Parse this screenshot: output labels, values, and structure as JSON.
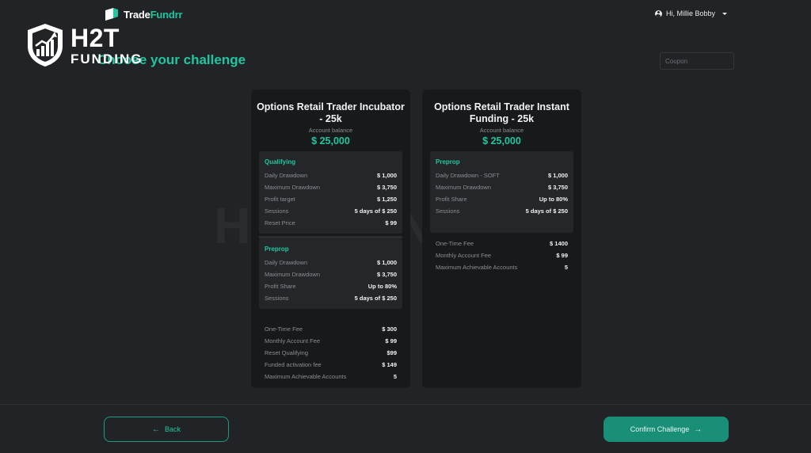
{
  "header": {
    "brand_part1": "Trade",
    "brand_part2": "Fundrr",
    "user_greeting": "Hi, Millie Bobby"
  },
  "watermark": {
    "line1": "H2T",
    "line2": "FUNDING",
    "center_text": "H2T FUNDING"
  },
  "page": {
    "title": "Choose your challenge",
    "coupon_placeholder": "Coupon"
  },
  "cards": [
    {
      "title": "Options Retail Trader Incubator - 25k",
      "subtitle": "Account balance",
      "balance": "$ 25,000",
      "panels": [
        {
          "heading": "Qualifying",
          "rows": [
            {
              "label": "Daily Drawdown",
              "value": "$ 1,000"
            },
            {
              "label": "Maximum Drawdown",
              "value": "$ 3,750"
            },
            {
              "label": "Profit target",
              "value": "$ 1,250"
            },
            {
              "label": "Sessions",
              "value": "5 days of $ 250"
            },
            {
              "label": "Reset Price",
              "value": "$ 99"
            }
          ]
        },
        {
          "heading": "Preprop",
          "rows": [
            {
              "label": "Daily Drawdown",
              "value": "$ 1,000"
            },
            {
              "label": "Maximum Drawdown",
              "value": "$ 3,750"
            },
            {
              "label": "Profit Share",
              "value": "Up to 80%"
            },
            {
              "label": "Sessions",
              "value": "5 days of $ 250"
            }
          ]
        }
      ],
      "fees": [
        {
          "label": "One-Time Fee",
          "value": "$ 300"
        },
        {
          "label": "Monthly Account Fee",
          "value": "$ 99"
        },
        {
          "label": "Reset Qualifying",
          "value": "$99"
        },
        {
          "label": "Funded activation fee",
          "value": "$ 149"
        },
        {
          "label": "Maximum Achievable Accounts",
          "value": "5"
        }
      ]
    },
    {
      "title": "Options Retail Trader Instant Funding - 25k",
      "subtitle": "Account balance",
      "balance": "$ 25,000",
      "panels": [
        {
          "heading": "Preprop",
          "rows": [
            {
              "label": "Daily Drawdown - SOFT",
              "value": "$ 1,000"
            },
            {
              "label": "Maximum Drawdown",
              "value": "$ 3,750"
            },
            {
              "label": "Profit Share",
              "value": "Up to 80%"
            },
            {
              "label": "Sessions",
              "value": "5 days of $ 250"
            }
          ]
        }
      ],
      "fees": [
        {
          "label": "One-Time Fee",
          "value": "$ 1400"
        },
        {
          "label": "Monthly Account Fee",
          "value": "$ 99"
        },
        {
          "label": "Maximum Achievable Accounts",
          "value": "5"
        }
      ]
    }
  ],
  "footer": {
    "back_label": "Back",
    "confirm_label": "Confirm Challenge"
  },
  "colors": {
    "accent": "#1ec7a0",
    "background": "#222326",
    "card": "#18191b",
    "panel": "#252629"
  },
  "icons": {
    "user": "user-circle-icon",
    "caret": "caret-down-icon",
    "back": "arrow-left-icon",
    "confirm": "arrow-right-icon"
  }
}
